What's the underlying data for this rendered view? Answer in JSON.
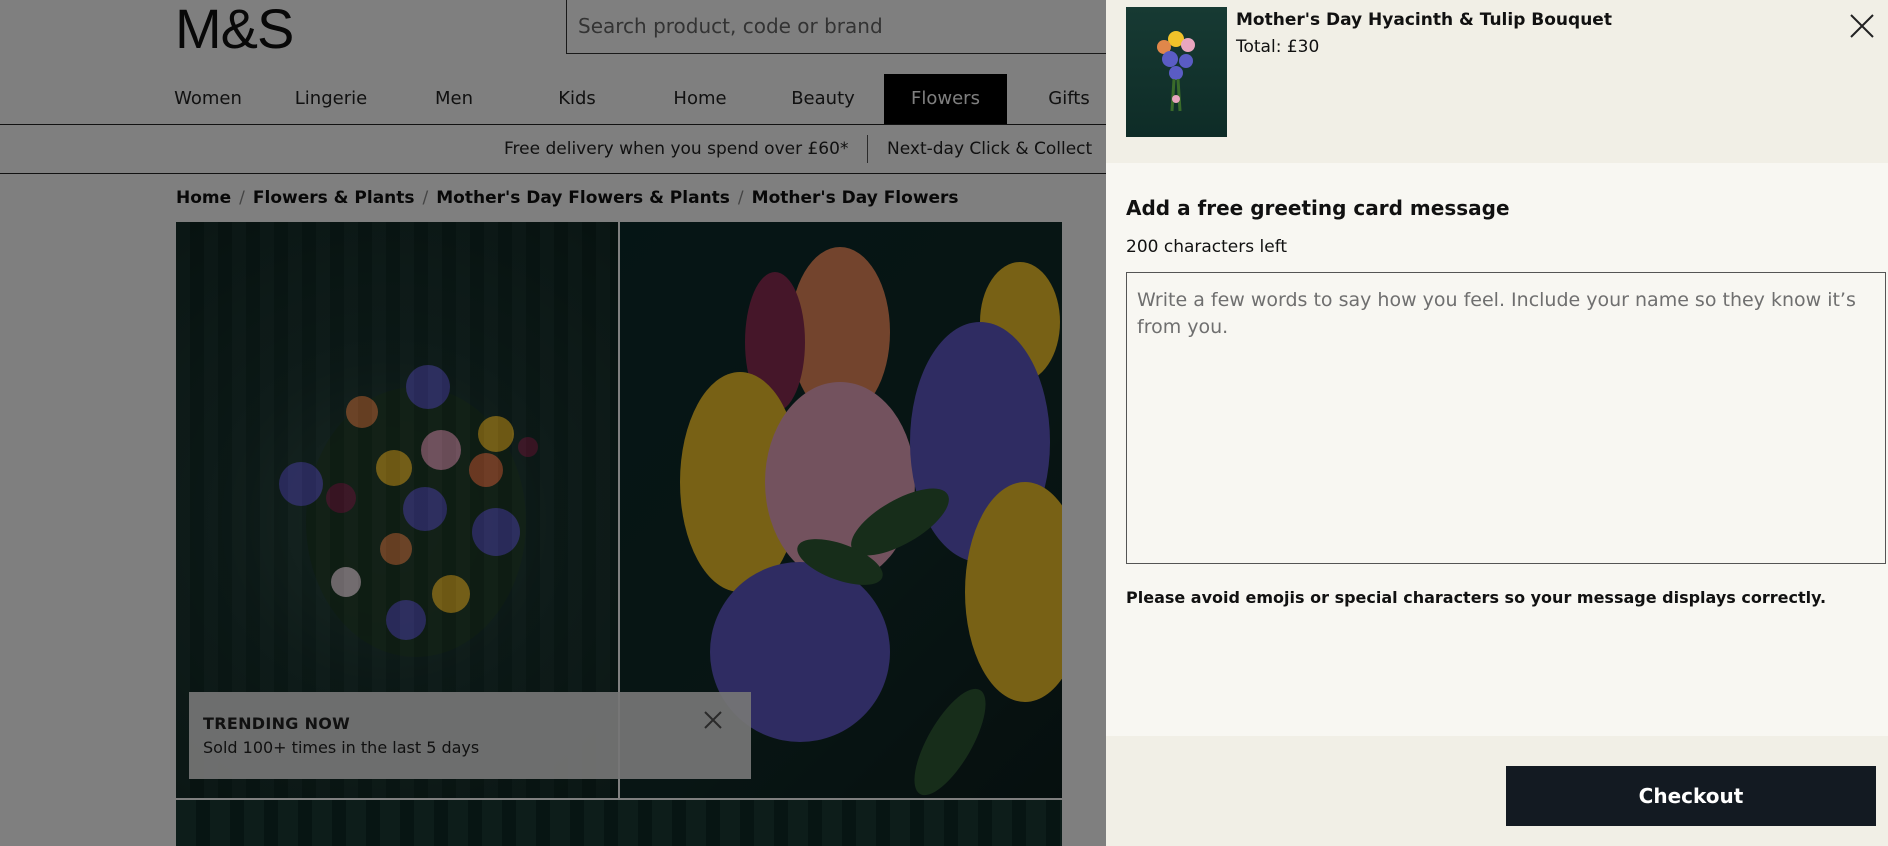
{
  "header": {
    "logo": "M&S",
    "search_placeholder": "Search product, code or brand"
  },
  "nav": {
    "items": [
      "Women",
      "Lingerie",
      "Men",
      "Kids",
      "Home",
      "Beauty",
      "Flowers",
      "Gifts"
    ],
    "active": "Flowers"
  },
  "promo": {
    "delivery": "Free delivery when you spend over £60*",
    "collect": "Next-day Click & Collect"
  },
  "breadcrumb": [
    "Home",
    "Flowers & Plants",
    "Mother's Day Flowers & Plants",
    "Mother's Day Flowers"
  ],
  "trending": {
    "title": "TRENDING NOW",
    "subtitle": "Sold 100+ times in the last 5 days"
  },
  "drawer": {
    "product_name": "Mother's Day Hyacinth & Tulip Bouquet",
    "total": "Total: £30",
    "heading": "Add a free greeting card message",
    "characters_left": "200 characters left",
    "message_placeholder": "Write a few words to say how you feel. Include your name so they know it’s from you.",
    "note": "Please avoid emojis or special characters so your message displays correctly.",
    "checkout_label": "Checkout"
  },
  "colors": {
    "nav_active_bg": "#000000",
    "checkout_bg": "#131a22",
    "drawer_bg": "#f8f7f2",
    "drawer_header_bg": "#f1efe6"
  }
}
